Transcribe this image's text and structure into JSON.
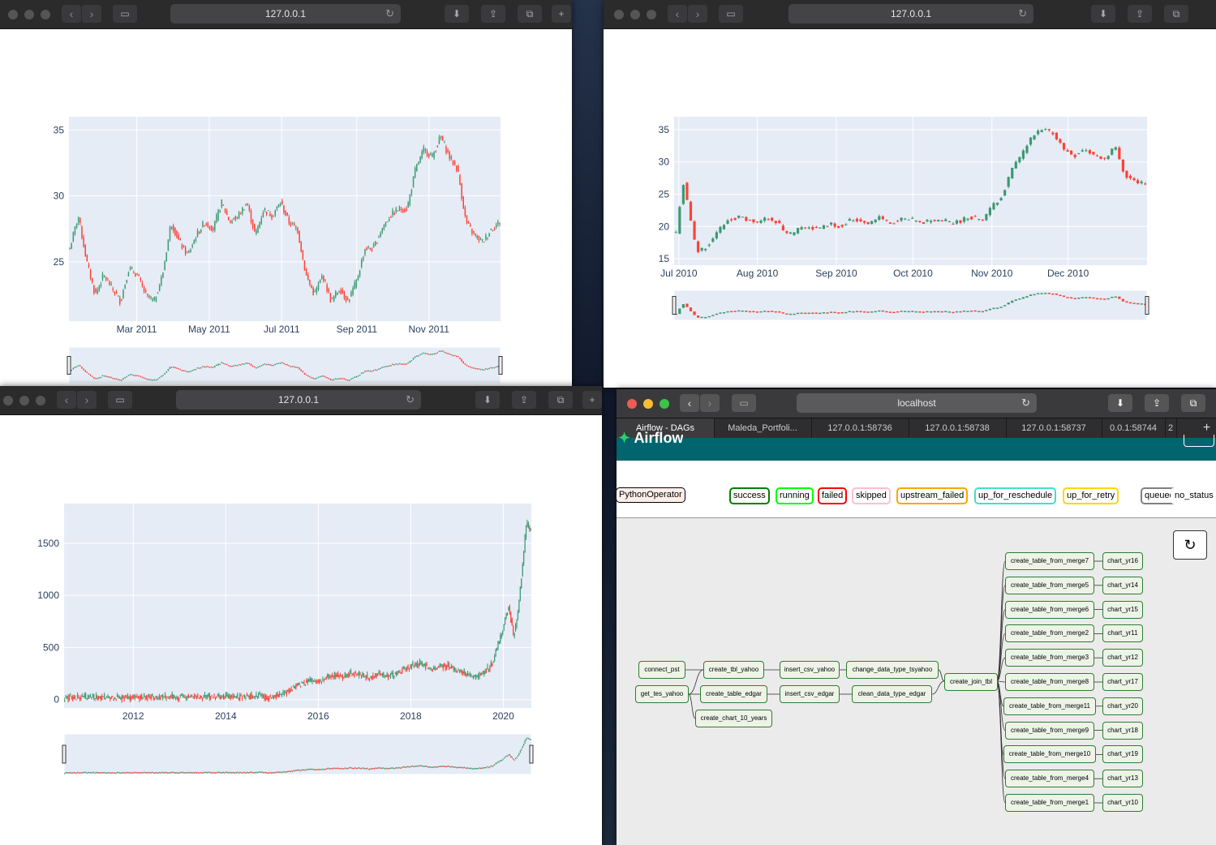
{
  "windows": {
    "w1": {
      "url": "127.0.0.1"
    },
    "w2": {
      "url": "127.0.0.1"
    },
    "w3": {
      "url": "127.0.0.1"
    },
    "w4": {
      "url": "localhost"
    }
  },
  "airflow": {
    "tabs": [
      "Airflow - DAGs",
      "Maleda_Portfoli...",
      "127.0.0.1:58736",
      "127.0.0.1:58738",
      "127.0.0.1:58737",
      "0.0.1:58744",
      "2"
    ],
    "header_text": "Airflow",
    "operator": "PythonOperator",
    "states": [
      {
        "label": "success",
        "color": "#008000"
      },
      {
        "label": "running",
        "color": "#00ff00"
      },
      {
        "label": "failed",
        "color": "#ff0000"
      },
      {
        "label": "skipped",
        "color": "#ffc0cb"
      },
      {
        "label": "upstream_failed",
        "color": "#ffa500"
      },
      {
        "label": "up_for_reschedule",
        "color": "#40e0d0"
      },
      {
        "label": "up_for_retry",
        "color": "#ffd700"
      },
      {
        "label": "queued",
        "color": "#808080"
      },
      {
        "label": "no_status",
        "color": "#ffffff"
      }
    ],
    "nodes": {
      "connect_pst": "connect_pst",
      "get_tes_yahoo": "get_tes_yahoo",
      "create_tbl_yahoo": "create_tbl_yahoo",
      "create_table_edgar": "create_table_edgar",
      "create_chart_10_years": "create_chart_10_years",
      "insert_csv_yahoo": "insert_csv_yahoo",
      "insert_csv_edgar": "insert_csv_edgar",
      "change_data_type_tsyahoo": "change_data_type_tsyahoo",
      "clean_data_type_edgar": "clean_data_type_edgar",
      "create_join_tbl": "create_join_tbl"
    },
    "merge_nodes": [
      "create_table_from_merge7",
      "create_table_from_merge5",
      "create_table_from_merge6",
      "create_table_from_merge2",
      "create_table_from_merge3",
      "create_table_from_merge8",
      "create_table_from_merge11",
      "create_table_from_merge9",
      "create_table_from_merge10",
      "create_table_from_merge4",
      "create_table_from_merge1"
    ],
    "chart_nodes": [
      "chart_yr16",
      "chart_yr14",
      "chart_yr15",
      "chart_yr11",
      "chart_yr12",
      "chart_yr17",
      "chart_yr20",
      "chart_yr18",
      "chart_yr19",
      "chart_yr13",
      "chart_yr10"
    ]
  },
  "chart_data": [
    {
      "type": "candlestick",
      "x_ticks": [
        "Mar 2011",
        "May 2011",
        "Jul 2011",
        "Sep 2011",
        "Nov 2011"
      ],
      "y_ticks": [
        25,
        30,
        35
      ],
      "ylim": [
        20.5,
        36
      ],
      "x_range": [
        "2011-01-01",
        "2011-12-31"
      ],
      "close_path": [
        [
          0,
          26
        ],
        [
          3,
          28.5
        ],
        [
          6,
          25
        ],
        [
          9,
          22.5
        ],
        [
          12,
          24
        ],
        [
          15,
          23
        ],
        [
          18,
          22
        ],
        [
          21,
          24.5
        ],
        [
          24,
          24
        ],
        [
          27,
          22.5
        ],
        [
          30,
          22
        ],
        [
          33,
          24
        ],
        [
          36,
          28
        ],
        [
          39,
          26.5
        ],
        [
          42,
          25.5
        ],
        [
          45,
          27
        ],
        [
          48,
          28
        ],
        [
          51,
          27.5
        ],
        [
          54,
          29.5
        ],
        [
          57,
          28
        ],
        [
          60,
          28.5
        ],
        [
          63,
          29.5
        ],
        [
          66,
          27
        ],
        [
          69,
          29
        ],
        [
          72,
          28.5
        ],
        [
          75,
          29.5
        ],
        [
          78,
          28
        ],
        [
          81,
          27.5
        ],
        [
          84,
          24
        ],
        [
          87,
          22.5
        ],
        [
          90,
          24
        ],
        [
          93,
          22
        ],
        [
          96,
          23
        ],
        [
          99,
          22
        ],
        [
          102,
          23.5
        ],
        [
          105,
          26
        ],
        [
          108,
          26
        ],
        [
          111,
          27.5
        ],
        [
          114,
          28.5
        ],
        [
          117,
          29
        ],
        [
          120,
          29
        ],
        [
          123,
          32
        ],
        [
          126,
          33.5
        ],
        [
          129,
          33
        ],
        [
          132,
          34.5
        ],
        [
          135,
          33
        ],
        [
          138,
          32
        ],
        [
          141,
          28
        ],
        [
          144,
          27
        ],
        [
          147,
          26.5
        ],
        [
          150,
          27.5
        ],
        [
          153,
          28
        ]
      ],
      "candle_count": 250,
      "increasing_color": "#3d9970",
      "decreasing_color": "#ff4136",
      "range_slider": true
    },
    {
      "type": "candlestick",
      "x_ticks": [
        "Jul 2010",
        "Aug 2010",
        "Sep 2010",
        "Oct 2010",
        "Nov 2010",
        "Dec 2010"
      ],
      "y_ticks": [
        15,
        20,
        25,
        30,
        35
      ],
      "ylim": [
        14,
        37
      ],
      "x_range": [
        "2010-07-01",
        "2010-12-31"
      ],
      "close_path": [
        [
          0,
          19
        ],
        [
          2,
          27
        ],
        [
          4,
          22
        ],
        [
          6,
          16
        ],
        [
          9,
          17
        ],
        [
          12,
          19
        ],
        [
          15,
          21
        ],
        [
          18,
          21.5
        ],
        [
          21,
          21
        ],
        [
          24,
          20.5
        ],
        [
          27,
          21.5
        ],
        [
          30,
          20.5
        ],
        [
          33,
          18.5
        ],
        [
          36,
          19.5
        ],
        [
          39,
          20
        ],
        [
          42,
          19.5
        ],
        [
          45,
          20.5
        ],
        [
          48,
          20
        ],
        [
          51,
          21
        ],
        [
          54,
          21
        ],
        [
          57,
          20.5
        ],
        [
          60,
          21.5
        ],
        [
          63,
          20.5
        ],
        [
          66,
          21
        ],
        [
          69,
          21
        ],
        [
          72,
          20.5
        ],
        [
          75,
          21
        ],
        [
          78,
          21
        ],
        [
          81,
          20.5
        ],
        [
          84,
          21
        ],
        [
          87,
          21.5
        ],
        [
          90,
          21
        ],
        [
          93,
          23
        ],
        [
          96,
          25
        ],
        [
          99,
          29
        ],
        [
          102,
          31.5
        ],
        [
          105,
          34
        ],
        [
          108,
          35
        ],
        [
          111,
          34.5
        ],
        [
          114,
          32
        ],
        [
          117,
          31
        ],
        [
          120,
          32
        ],
        [
          123,
          31
        ],
        [
          126,
          30.5
        ],
        [
          129,
          32.5
        ],
        [
          132,
          28
        ],
        [
          135,
          27
        ],
        [
          138,
          26.5
        ]
      ],
      "candle_count": 128,
      "increasing_color": "#3d9970",
      "decreasing_color": "#ff4136",
      "range_slider": true
    },
    {
      "type": "candlestick",
      "x_ticks": [
        "2012",
        "2014",
        "2016",
        "2018",
        "2020"
      ],
      "y_ticks": [
        0,
        500,
        1000,
        1500
      ],
      "ylim": [
        -80,
        1880
      ],
      "x_range": [
        "2010-06-29",
        "2020-08-01"
      ],
      "close_path": [
        [
          0,
          20
        ],
        [
          10,
          22
        ],
        [
          20,
          25
        ],
        [
          30,
          28
        ],
        [
          40,
          32
        ],
        [
          48,
          30
        ],
        [
          50,
          55
        ],
        [
          53,
          130
        ],
        [
          56,
          180
        ],
        [
          58,
          170
        ],
        [
          60,
          200
        ],
        [
          62,
          240
        ],
        [
          64,
          230
        ],
        [
          66,
          250
        ],
        [
          68,
          240
        ],
        [
          70,
          210
        ],
        [
          72,
          260
        ],
        [
          74,
          220
        ],
        [
          76,
          240
        ],
        [
          78,
          300
        ],
        [
          80,
          330
        ],
        [
          82,
          350
        ],
        [
          84,
          300
        ],
        [
          86,
          320
        ],
        [
          88,
          330
        ],
        [
          90,
          270
        ],
        [
          92,
          260
        ],
        [
          94,
          200
        ],
        [
          96,
          250
        ],
        [
          98,
          330
        ],
        [
          100,
          600
        ],
        [
          102,
          900
        ],
        [
          103,
          600
        ],
        [
          104,
          800
        ],
        [
          106,
          1700
        ],
        [
          107,
          1600
        ]
      ],
      "candle_count": 400,
      "increasing_color": "#3d9970",
      "decreasing_color": "#ff4136",
      "range_slider": true
    }
  ]
}
